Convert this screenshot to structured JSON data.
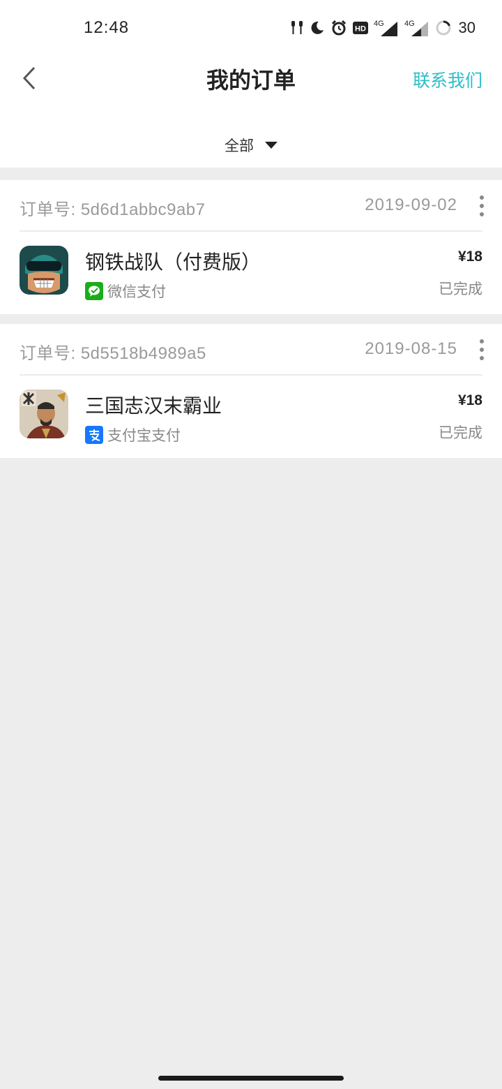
{
  "status_bar": {
    "time": "12:48",
    "icons": [
      "earbuds-icon",
      "moon-icon",
      "alarm-icon",
      "hd-icon",
      "4g-signal-icon",
      "4g-signal-icon",
      "battery-ring-icon"
    ],
    "network_label": "4G",
    "hd_label": "HD",
    "battery": "30"
  },
  "header": {
    "title": "我的订单",
    "contact": "联系我们",
    "filter_label": "全部"
  },
  "orders": [
    {
      "order_no": "订单号: 5d6d1abbc9ab7",
      "date": "2019-09-02",
      "app_name": "钢铁战队（付费版）",
      "payment": "微信支付",
      "price": "¥18",
      "status": "已完成"
    },
    {
      "order_no": "订单号: 5d5518b4989a5",
      "date": "2019-08-15",
      "app_name": "三国志汉末霸业",
      "payment": "支付宝支付",
      "price": "¥18",
      "status": "已完成"
    }
  ],
  "colors": {
    "accent": "#2bc0c8",
    "background": "#ededed",
    "wechat_green": "#1aad19",
    "alipay_blue": "#1677ff"
  }
}
